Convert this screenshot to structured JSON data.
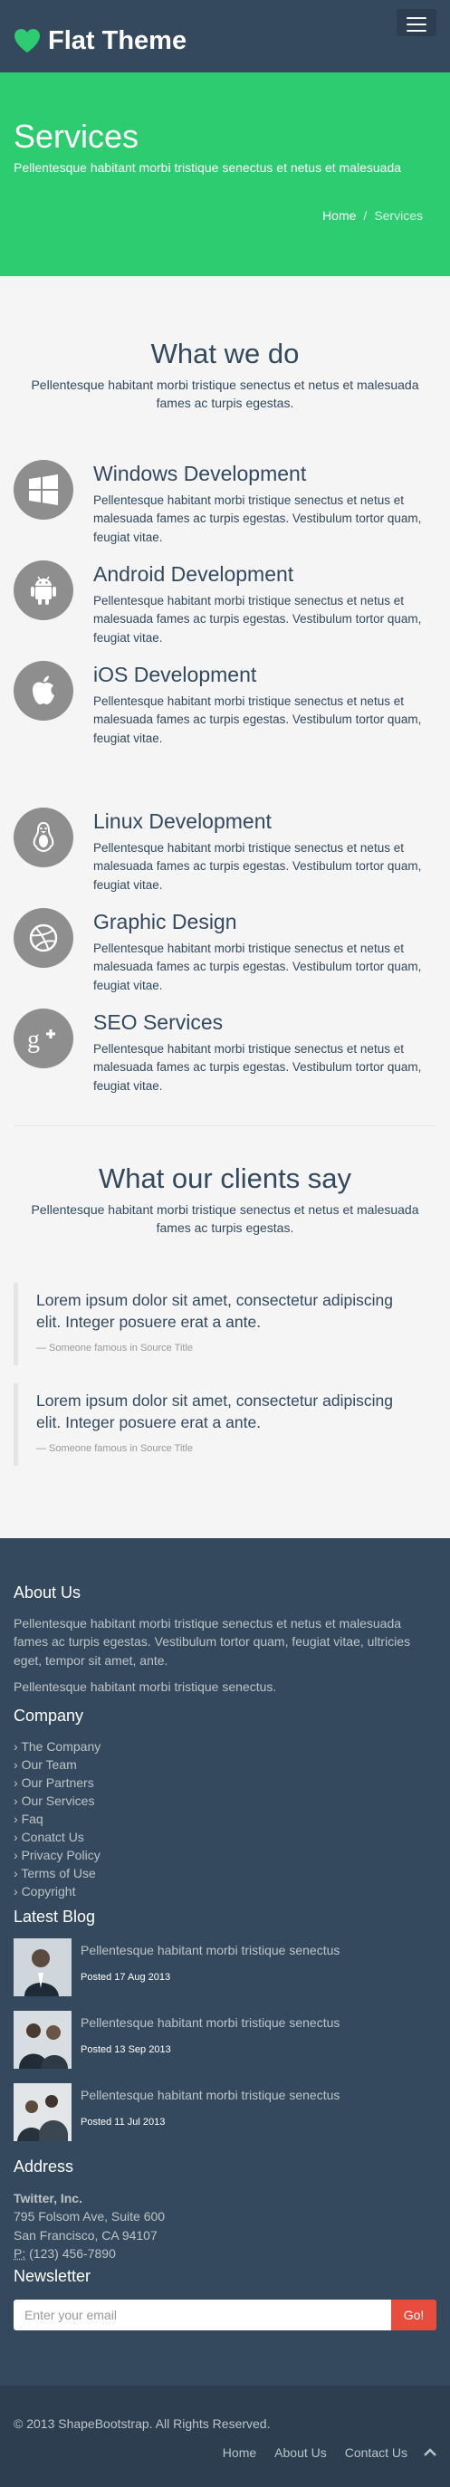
{
  "brand": {
    "name": "Flat Theme",
    "icon": "heart-icon"
  },
  "title_bar": {
    "title": "Services",
    "subtitle": "Pellentesque habitant morbi tristique senectus et netus et malesuada",
    "breadcrumb": {
      "home": "Home",
      "separator": "/",
      "current": "Services"
    }
  },
  "what_we_do": {
    "heading": "What we do",
    "lead": "Pellentesque habitant morbi tristique senectus et netus et malesuada fames ac turpis egestas.",
    "services": [
      {
        "icon": "windows-icon",
        "title": "Windows Development",
        "text": "Pellentesque habitant morbi tristique senectus et netus et malesuada fames ac turpis egestas. Vestibulum tortor quam, feugiat vitae."
      },
      {
        "icon": "android-icon",
        "title": "Android Development",
        "text": "Pellentesque habitant morbi tristique senectus et netus et malesuada fames ac turpis egestas. Vestibulum tortor quam, feugiat vitae."
      },
      {
        "icon": "apple-icon",
        "title": "iOS Development",
        "text": "Pellentesque habitant morbi tristique senectus et netus et malesuada fames ac turpis egestas. Vestibulum tortor quam, feugiat vitae."
      },
      {
        "icon": "linux-icon",
        "title": "Linux Development",
        "text": "Pellentesque habitant morbi tristique senectus et netus et malesuada fames ac turpis egestas. Vestibulum tortor quam, feugiat vitae."
      },
      {
        "icon": "dribbble-icon",
        "title": "Graphic Design",
        "text": "Pellentesque habitant morbi tristique senectus et netus et malesuada fames ac turpis egestas. Vestibulum tortor quam, feugiat vitae."
      },
      {
        "icon": "google-plus-icon",
        "title": "SEO Services",
        "text": "Pellentesque habitant morbi tristique senectus et netus et malesuada fames ac turpis egestas. Vestibulum tortor quam, feugiat vitae."
      }
    ]
  },
  "clients": {
    "heading": "What our clients say",
    "lead": "Pellentesque habitant morbi tristique senectus et netus et malesuada fames ac turpis egestas.",
    "quotes": [
      {
        "text": "Lorem ipsum dolor sit amet, consectetur adipiscing elit. Integer posuere erat a ante.",
        "source": "— Someone famous in Source Title"
      },
      {
        "text": "Lorem ipsum dolor sit amet, consectetur adipiscing elit. Integer posuere erat a ante.",
        "source": "— Someone famous in Source Title"
      }
    ]
  },
  "footer": {
    "about": {
      "heading": "About Us",
      "p1": "Pellentesque habitant morbi tristique senectus et netus et malesuada fames ac turpis egestas. Vestibulum tortor quam, feugiat vitae, ultricies eget, tempor sit amet, ante.",
      "p2": "Pellentesque habitant morbi tristique senectus."
    },
    "company": {
      "heading": "Company",
      "links": [
        "The Company",
        "Our Team",
        "Our Partners",
        "Our Services",
        "Faq",
        "Conatct Us",
        "Privacy Policy",
        "Terms of Use",
        "Copyright"
      ]
    },
    "blog": {
      "heading": "Latest Blog",
      "posts": [
        {
          "title": "Pellentesque habitant morbi tristique senectus",
          "date": "Posted 17 Aug 2013"
        },
        {
          "title": "Pellentesque habitant morbi tristique senectus",
          "date": "Posted 13 Sep 2013"
        },
        {
          "title": "Pellentesque habitant morbi tristique senectus",
          "date": "Posted 11 Jul 2013"
        }
      ]
    },
    "address": {
      "heading": "Address",
      "company": "Twitter, Inc.",
      "line1": "795 Folsom Ave, Suite 600",
      "line2": "San Francisco, CA 94107",
      "phone_label": "P:",
      "phone": "(123) 456-7890"
    },
    "newsletter": {
      "heading": "Newsletter",
      "placeholder": "Enter your email",
      "button": "Go!"
    }
  },
  "bottom": {
    "copyright": "© 2013 ShapeBootstrap. All Rights Reserved.",
    "links": [
      "Home",
      "About Us",
      "Contact Us"
    ]
  },
  "colors": {
    "navy": "#34495e",
    "green": "#2ecc71",
    "red": "#e74c3c",
    "circle": "#8e8e8e"
  }
}
